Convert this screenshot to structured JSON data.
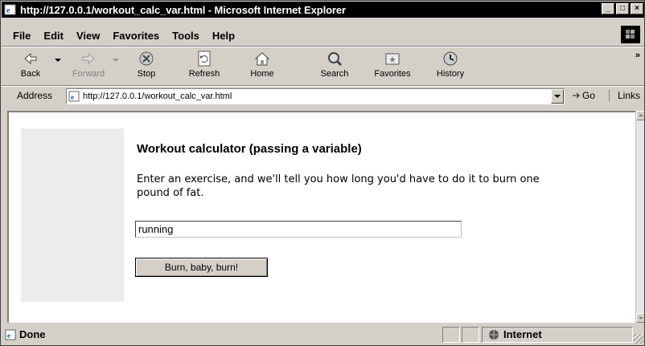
{
  "window": {
    "title": "http://127.0.0.1/workout_calc_var.html - Microsoft Internet Explorer",
    "controls": [
      "minimize",
      "maximize",
      "close"
    ]
  },
  "menu": {
    "items": [
      {
        "label": "File"
      },
      {
        "label": "Edit"
      },
      {
        "label": "View"
      },
      {
        "label": "Favorites"
      },
      {
        "label": "Tools"
      },
      {
        "label": "Help"
      }
    ]
  },
  "toolbar": {
    "buttons": [
      {
        "label": "Back",
        "icon": "back-arrow-icon",
        "enabled": true
      },
      {
        "label": "Forward",
        "icon": "forward-arrow-icon",
        "enabled": false
      },
      {
        "label": "Stop",
        "icon": "stop-icon",
        "enabled": true
      },
      {
        "label": "Refresh",
        "icon": "refresh-icon",
        "enabled": true
      },
      {
        "label": "Home",
        "icon": "home-icon",
        "enabled": true
      },
      {
        "label": "Search",
        "icon": "search-icon",
        "enabled": true
      },
      {
        "label": "Favorites",
        "icon": "favorites-icon",
        "enabled": true
      },
      {
        "label": "History",
        "icon": "history-icon",
        "enabled": true
      }
    ],
    "more": "»"
  },
  "address": {
    "label": "Address",
    "url": "http://127.0.0.1/workout_calc_var.html",
    "go_label": "Go",
    "links_label": "Links"
  },
  "page": {
    "heading": "Workout calculator (passing a variable)",
    "intro": "Enter an exercise, and we'll tell you how long you'd have to do it to burn one pound of fat.",
    "exercise_value": "running",
    "submit_label": "Burn, baby, burn!"
  },
  "status": {
    "text": "Done",
    "zone": "Internet"
  },
  "colors": {
    "chrome": "#d4d0c8",
    "titlebar": "#000000",
    "sidebar": "#ececec"
  }
}
